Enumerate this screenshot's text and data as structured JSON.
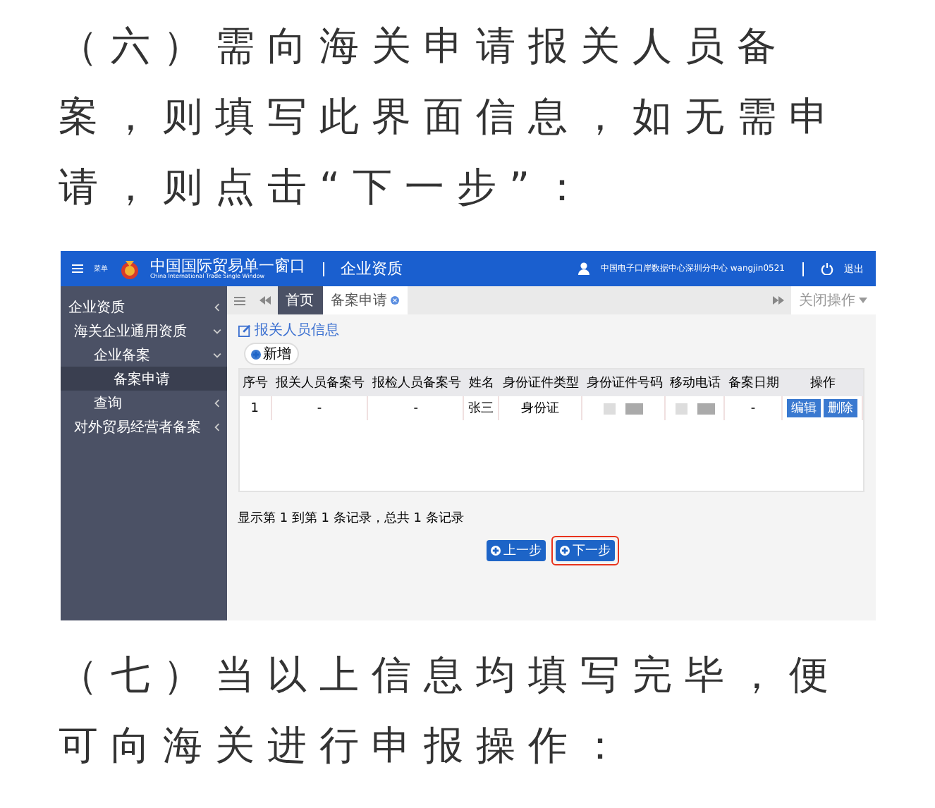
{
  "intro": "（六）需向海关申请报关人员备案，则填写此界面信息，如无需申请，则点击“下一步”：",
  "app": {
    "header": {
      "menu_label": "菜单",
      "logo_title": "中国国际贸易单一窗口",
      "logo_subtitle": "China International Trade Single Window",
      "module": "企业资质",
      "user": "中国电子口岸数据中心深圳分中心 wangjin0521",
      "logout": "退出"
    },
    "sidebar": {
      "title": "企业资质",
      "items": [
        {
          "label": "海关企业通用资质",
          "expanded": true,
          "selected": false,
          "children": [
            {
              "label": "企业备案",
              "expanded": true,
              "selected": false,
              "children": [
                {
                  "label": "备案申请",
                  "selected": true
                }
              ]
            },
            {
              "label": "查询",
              "expanded": false,
              "selected": false
            }
          ]
        },
        {
          "label": "对外贸易经营者备案",
          "expanded": false,
          "selected": false
        }
      ]
    },
    "tabs": [
      {
        "label": "首页",
        "selected": true,
        "closable": false
      },
      {
        "label": "备案申请",
        "selected": false,
        "closable": true
      }
    ],
    "close_menu": "关闭操作",
    "section_title": "报关人员信息",
    "add_button": "新增",
    "table": {
      "columns": [
        "序号",
        "报关人员备案号",
        "报检人员备案号",
        "姓名",
        "身份证件类型",
        "身份证件号码",
        "移动电话",
        "备案日期",
        "操作"
      ],
      "rows": [
        {
          "cells": [
            {
              "kind": "text",
              "text": "1"
            },
            {
              "kind": "text",
              "text": "-"
            },
            {
              "kind": "text",
              "text": "-"
            },
            {
              "kind": "text",
              "text": "张三"
            },
            {
              "kind": "text",
              "text": "身份证"
            },
            {
              "kind": "redacted"
            },
            {
              "kind": "redacted"
            },
            {
              "kind": "text",
              "text": "-"
            },
            {
              "kind": "actions",
              "buttons": [
                "编辑",
                "删除"
              ]
            }
          ]
        }
      ]
    },
    "pagination_info": "显示第 1 到第 1 条记录，总共 1 条记录",
    "nav_buttons": [
      {
        "label": "上一步",
        "highlighted": false
      },
      {
        "label": "下一步",
        "highlighted": true
      }
    ]
  },
  "outro": "（七）当以上信息均填写完毕，便可向海关进行申报操作："
}
